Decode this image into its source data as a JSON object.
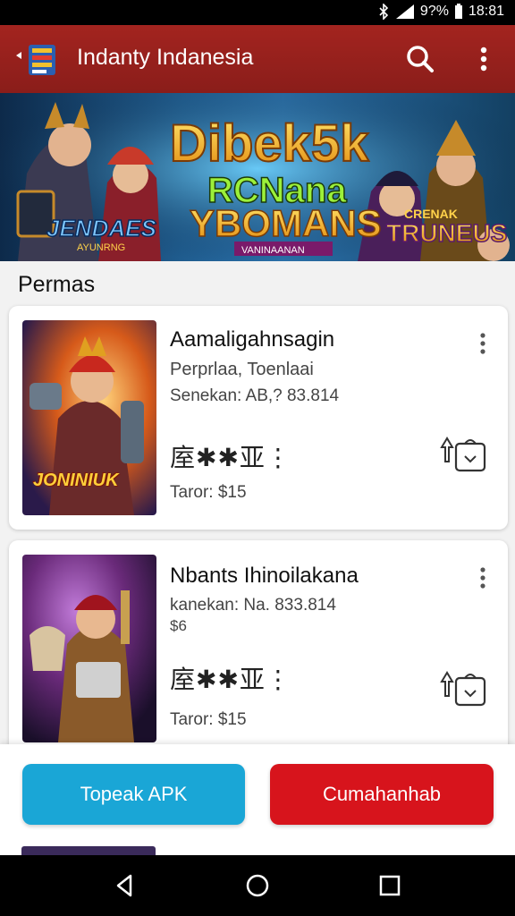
{
  "status_bar": {
    "battery": "9?%",
    "time": "18:81"
  },
  "app_bar": {
    "title": "Indanty Indanesia",
    "search_icon": "search-icon",
    "menu_icon": "more-vert-icon"
  },
  "banner": {
    "headline_1": "Dibek5k",
    "headline_2": "RCNana",
    "headline_3": "YBOMANS",
    "left_logo": "JENDAES",
    "left_sub": "AYUNRNG",
    "right_logo_top": "CRENAK",
    "right_logo": "TRUNEUS",
    "center_tag": "VANINAANAN"
  },
  "section": {
    "title": "Permas"
  },
  "games": [
    {
      "title": "Aamaligahnsagin",
      "subtitle": "Perprlaa, Toenlaai",
      "info": "Senekan: AB,? 83.814",
      "rating_glyphs": "庢✱✱亚⋮",
      "price": "Taror: $15",
      "thumb_label": "JONINIUK",
      "menu_icon": "more-vert-icon",
      "download_icon": "download-icon"
    },
    {
      "title": "Nbants Ihinoilakana",
      "subtitle": "kanekan: Na. 833.814",
      "info": "$6",
      "rating_glyphs": "庢✱✱亚⋮",
      "price": "Taror: $15",
      "thumb_label": "",
      "menu_icon": "more-vert-icon",
      "download_icon": "download-icon"
    }
  ],
  "actions": {
    "primary": "Topeak APK",
    "secondary": "Cumahanhab"
  },
  "colors": {
    "app_bar": "#a3241f",
    "primary_button": "#1aa6d6",
    "secondary_button": "#d7141c"
  },
  "nav": {
    "back_icon": "back-triangle-icon",
    "home_icon": "home-circle-icon",
    "recents_icon": "recents-square-icon"
  }
}
